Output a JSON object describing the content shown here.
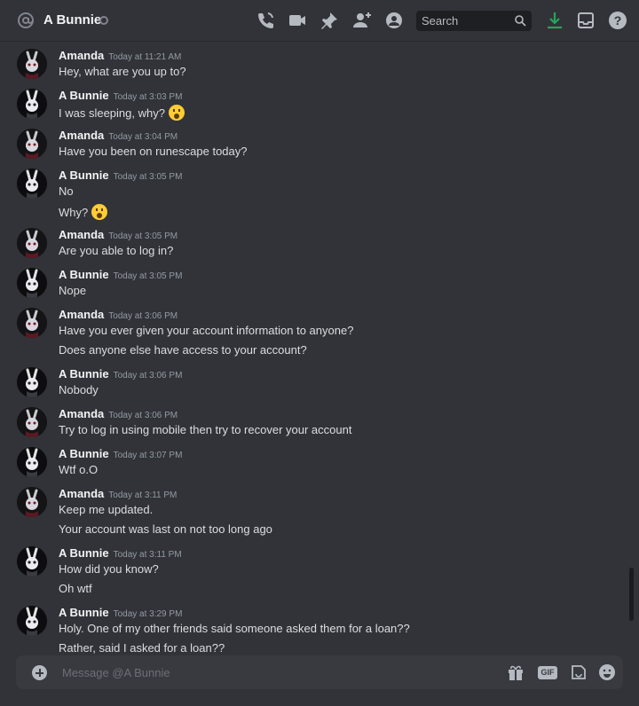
{
  "header": {
    "channel_name": "A Bunnie",
    "search_placeholder": "Search",
    "icons": [
      "at-icon",
      "call-icon",
      "video-icon",
      "pin-icon",
      "add-friend-icon",
      "profile-icon",
      "download-icon",
      "inbox-icon",
      "help-icon"
    ]
  },
  "messages": [
    {
      "author": "Amanda",
      "time": "Today at 11:21 AM",
      "lines": [
        {
          "text": "Hey, what are you up to?"
        }
      ]
    },
    {
      "author": "A Bunnie",
      "time": "Today at 3:03 PM",
      "lines": [
        {
          "text": "I was sleeping, why?",
          "emoji": "astonished-face-emoji"
        }
      ]
    },
    {
      "author": "Amanda",
      "time": "Today at 3:04 PM",
      "lines": [
        {
          "text": "Have you been on runescape today?"
        }
      ]
    },
    {
      "author": "A Bunnie",
      "time": "Today at 3:05 PM",
      "lines": [
        {
          "text": "No"
        },
        {
          "text": "Why?",
          "emoji": "astonished-face-emoji"
        }
      ]
    },
    {
      "author": "Amanda",
      "time": "Today at 3:05 PM",
      "lines": [
        {
          "text": "Are you able to log in?"
        }
      ]
    },
    {
      "author": "A Bunnie",
      "time": "Today at 3:05 PM",
      "lines": [
        {
          "text": "Nope"
        }
      ]
    },
    {
      "author": "Amanda",
      "time": "Today at 3:06 PM",
      "lines": [
        {
          "text": "Have you ever given your account information to anyone?"
        },
        {
          "text": "Does anyone else have access to your account?"
        }
      ]
    },
    {
      "author": "A Bunnie",
      "time": "Today at 3:06 PM",
      "lines": [
        {
          "text": "Nobody"
        }
      ]
    },
    {
      "author": "Amanda",
      "time": "Today at 3:06 PM",
      "lines": [
        {
          "text": "Try to log in using mobile then try to recover your account"
        }
      ]
    },
    {
      "author": "A Bunnie",
      "time": "Today at 3:07 PM",
      "lines": [
        {
          "text": "Wtf o.O"
        }
      ]
    },
    {
      "author": "Amanda",
      "time": "Today at 3:11 PM",
      "lines": [
        {
          "text": "Keep me updated."
        },
        {
          "text": "Your account was last on not too long ago"
        }
      ]
    },
    {
      "author": "A Bunnie",
      "time": "Today at 3:11 PM",
      "lines": [
        {
          "text": "How did you know?"
        },
        {
          "text": "Oh wtf"
        }
      ]
    },
    {
      "author": "A Bunnie",
      "time": "Today at 3:29 PM",
      "lines": [
        {
          "text": "Holy. One of my other friends said someone asked them for a loan??"
        },
        {
          "text": "Rather, said I asked for a loan??"
        }
      ]
    }
  ],
  "composer": {
    "placeholder": "Message @A Bunnie",
    "gif_label": "GIF",
    "icons": [
      "add-attachment-icon",
      "gift-icon",
      "gif-icon",
      "sticker-icon",
      "emoji-icon"
    ]
  }
}
